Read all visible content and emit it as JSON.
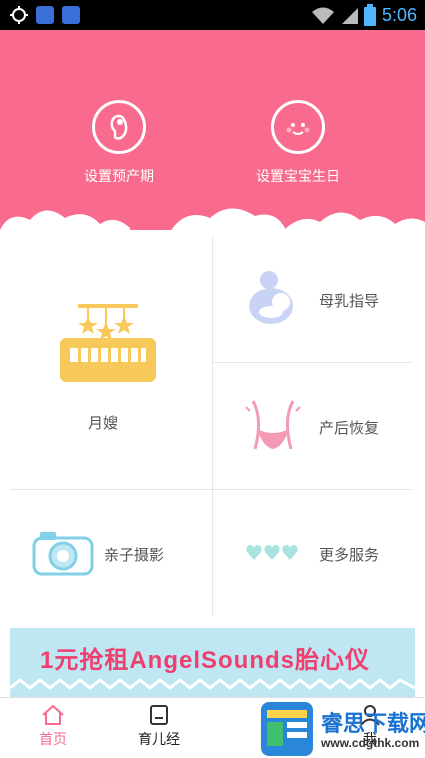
{
  "status_bar": {
    "time": "5:06"
  },
  "hero": {
    "background_color": "#f86b8f",
    "items": [
      {
        "label": "设置预产期",
        "icon": "fetus-icon"
      },
      {
        "label": "设置宝宝生日",
        "icon": "baby-face-icon"
      }
    ]
  },
  "services": [
    {
      "label": "月嫂",
      "icon": "crib-icon"
    },
    {
      "label": "母乳指导",
      "icon": "breastfeeding-icon"
    },
    {
      "label": "产后恢复",
      "icon": "waist-icon"
    },
    {
      "label": "亲子摄影",
      "icon": "camera-icon"
    },
    {
      "label": "更多服务",
      "icon": "hearts-icon"
    }
  ],
  "banner": {
    "text": "1元抢租AngelSounds胎心仪"
  },
  "bottom_nav": [
    {
      "label": "首页",
      "icon": "home-icon",
      "active": true
    },
    {
      "label": "育儿经",
      "icon": "book-icon",
      "active": false
    },
    {
      "label": "我",
      "icon": "person-icon",
      "active": false
    }
  ],
  "watermark": {
    "title": "睿思下载网",
    "url": "www.cdgthk.com"
  },
  "colors": {
    "accent": "#f86b8f",
    "nav_active": "#f86b8f",
    "crib": "#f7c95b",
    "icon_blue": "#7fd0e8"
  }
}
